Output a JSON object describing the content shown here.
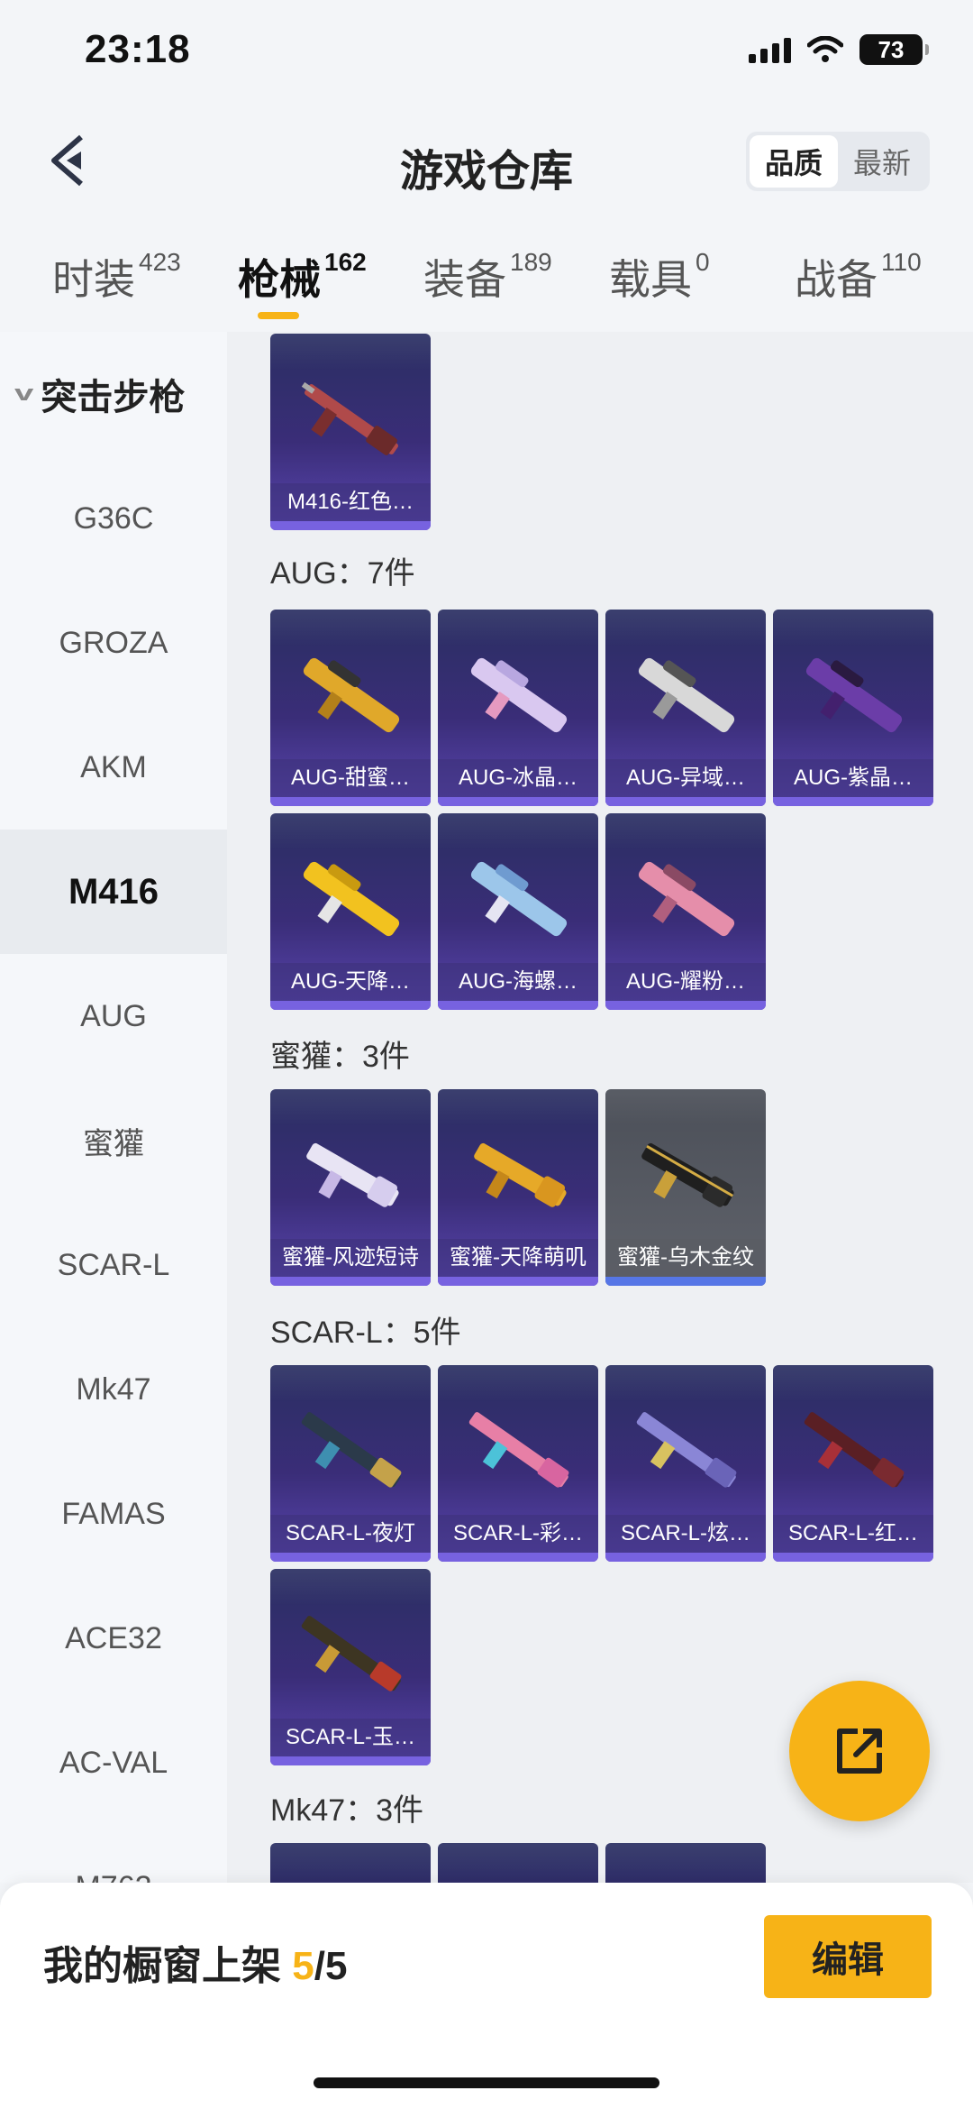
{
  "status_bar": {
    "time": "23:18",
    "battery": "73"
  },
  "header": {
    "title": "游戏仓库",
    "sort_quality": "品质",
    "sort_newest": "最新"
  },
  "tabs": [
    {
      "label": "时装",
      "count": "423"
    },
    {
      "label": "枪械",
      "count": "162"
    },
    {
      "label": "装备",
      "count": "189"
    },
    {
      "label": "载具",
      "count": "0"
    },
    {
      "label": "战备",
      "count": "110"
    }
  ],
  "sidebar": {
    "group": "突击步枪",
    "items": [
      "G36C",
      "GROZA",
      "AKM",
      "M416",
      "AUG",
      "蜜獾",
      "SCAR-L",
      "Mk47",
      "FAMAS",
      "ACE32",
      "AC-VAL",
      "M762"
    ]
  },
  "sections": {
    "m416": {
      "items": [
        "M416-红色…"
      ]
    },
    "aug": {
      "title": "AUG：7件",
      "items": [
        "AUG-甜蜜…",
        "AUG-冰晶…",
        "AUG-异域…",
        "AUG-紫晶…",
        "AUG-天降…",
        "AUG-海螺…",
        "AUG-耀粉…"
      ]
    },
    "honeybadger": {
      "title": "蜜獾：3件",
      "items": [
        "蜜獾-风迹短诗",
        "蜜獾-天降萌叽",
        "蜜獾-乌木金纹"
      ]
    },
    "scarl": {
      "title": "SCAR-L：5件",
      "items": [
        "SCAR-L-夜灯",
        "SCAR-L-彩…",
        "SCAR-L-炫…",
        "SCAR-L-红…",
        "SCAR-L-玉…"
      ]
    },
    "mk47": {
      "title": "Mk47：3件"
    }
  },
  "bottom": {
    "shelf_label": "我的橱窗上架",
    "shelf_count": "5",
    "shelf_total": "/5",
    "edit": "编辑"
  },
  "colors": {
    "accent": "#f7b317",
    "card_purple": "#3a2d78",
    "card_gray": "#5a5d65"
  }
}
